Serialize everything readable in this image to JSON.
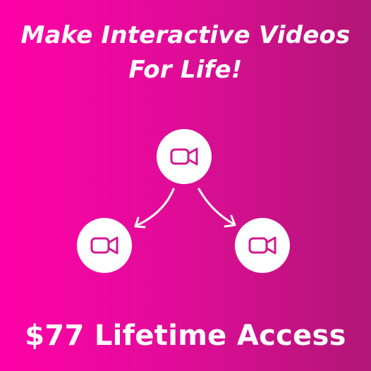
{
  "headline": {
    "line1": "Make Interactive Videos",
    "line2": "For Life!"
  },
  "price_text": "$77 Lifetime Access",
  "nodes": [
    {
      "icon": "video-camera-icon"
    },
    {
      "icon": "video-camera-icon"
    },
    {
      "icon": "video-camera-icon"
    }
  ],
  "colors": {
    "gradient_start": "#ff00a8",
    "gradient_end": "#b21677",
    "icon_color": "#d2178f",
    "foreground": "#ffffff"
  }
}
